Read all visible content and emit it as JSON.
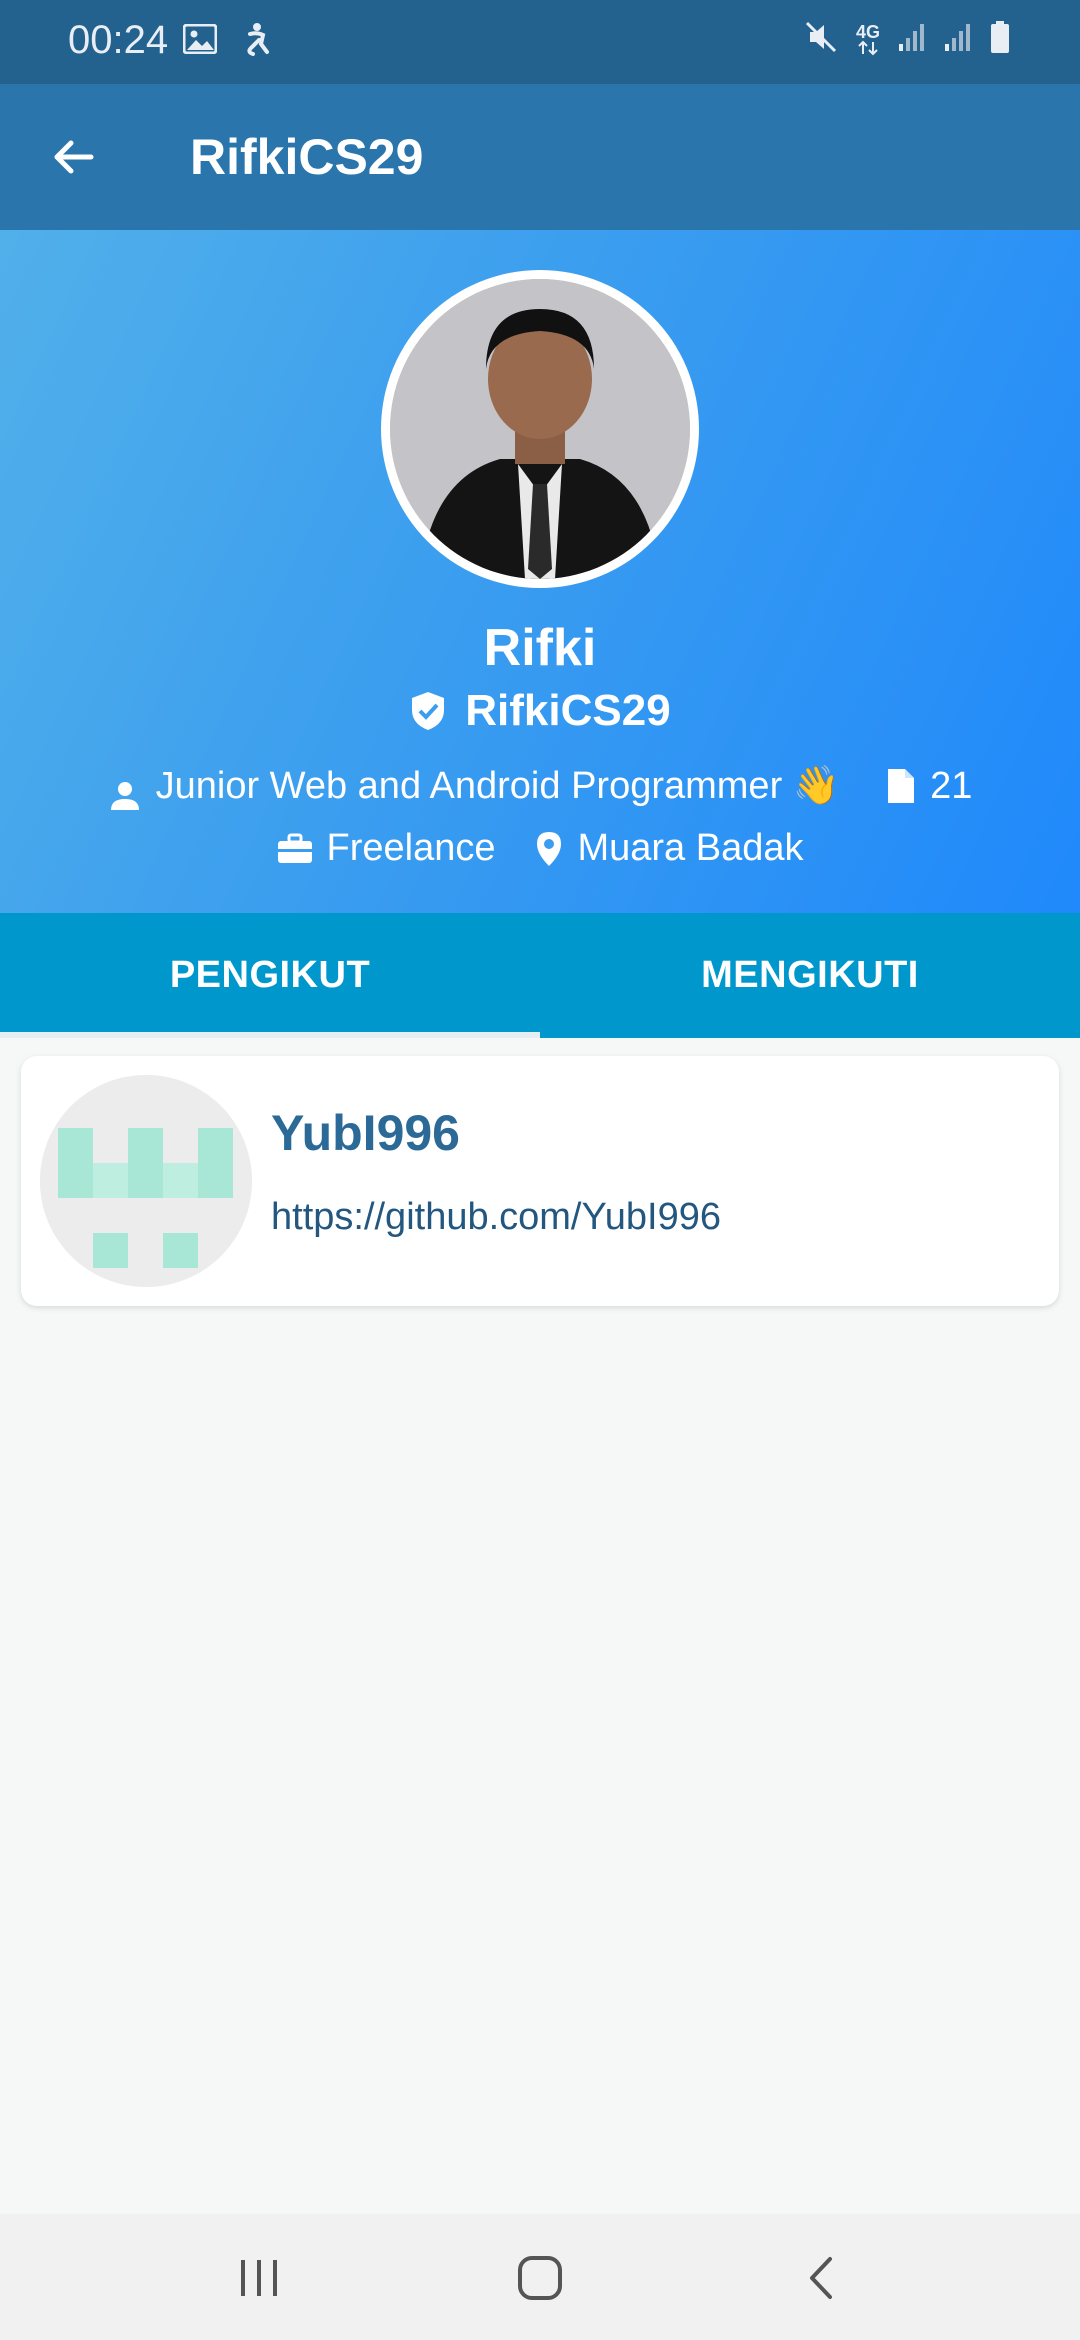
{
  "status_bar": {
    "time": "00:24",
    "left_icons": [
      "image-icon",
      "accessibility-icon"
    ],
    "right_icons": [
      "mute-icon",
      "4g-icon",
      "signal-icon",
      "signal-icon",
      "battery-icon"
    ],
    "network_label": "4G"
  },
  "app_bar": {
    "title": "RifkiCS29",
    "back_icon": "arrow-left-icon"
  },
  "profile": {
    "name": "Rifki",
    "username": "RifkiCS29",
    "bio": "Junior Web and Android Programmer 👋",
    "repositories": "21",
    "company": "Freelance",
    "location": "Muara Badak",
    "gradient": [
      "#51b0ea",
      "#2089fb"
    ]
  },
  "tabs": [
    {
      "label": "PENGIKUT",
      "selected": true
    },
    {
      "label": "MENGIKUTI",
      "selected": false
    }
  ],
  "list": [
    {
      "username": "YubI996",
      "url": "https://github.com/YubI996"
    }
  ],
  "colors": {
    "status_bar": "#23618f",
    "app_bar": "#2a75ab",
    "tab_bar": "#0098cc",
    "card_title": "#2b6a97",
    "identicon": "#a8e6d5"
  },
  "nav_bar": {
    "icons": [
      "recents-icon",
      "home-icon",
      "back-icon"
    ]
  }
}
